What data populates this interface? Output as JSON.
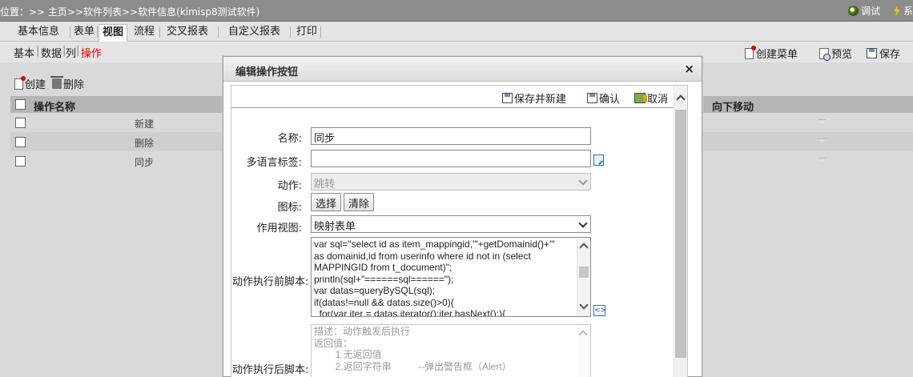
{
  "topbar": {
    "breadcrumb": "位置：>> 主页>>软件列表>>软件信息(kimisp8测试软件)",
    "debug_label": "调试",
    "sys_label": "系"
  },
  "tabs": [
    {
      "label": "基本信息"
    },
    {
      "label": "表单"
    },
    {
      "label": "视图"
    },
    {
      "label": "流程"
    },
    {
      "label": "交叉报表"
    },
    {
      "label": "自定义报表"
    },
    {
      "label": "打印"
    }
  ],
  "subtabs": [
    {
      "label": "基本"
    },
    {
      "label": "数据"
    },
    {
      "label": "列"
    },
    {
      "label": "操作"
    }
  ],
  "actions_right": {
    "create_menu": "创建菜单",
    "preview": "预览",
    "save": "保存"
  },
  "list": {
    "create": "创建",
    "delete": "删除",
    "col_name": "操作名称",
    "col_move": "向下移动",
    "rows": [
      {
        "name": "新建"
      },
      {
        "name": "删除"
      },
      {
        "name": "同步"
      }
    ]
  },
  "dialog": {
    "title": "编辑操作按钮",
    "close": "×",
    "save_new": "保存并新建",
    "confirm": "确认",
    "cancel": "取消",
    "fields": {
      "name_label": "名称:",
      "name_value": "同步",
      "i18n_label": "多语言标签:",
      "i18n_value": "",
      "action_label": "动作:",
      "action_value": "跳转",
      "icon_label": "图标:",
      "icon_select": "选择",
      "icon_clear": "清除",
      "view_label": "作用视图:",
      "view_value": "映射表单",
      "pre_script_label": "动作执行前脚本:",
      "pre_script": "var sql=\"select id as item_mappingid,'\"+getDomainid()+\"'\nas domainid,id from userinfo where id not in (select\nMAPPINGID from t_document)\";\nprintln(sql+\"======sql======\");\nvar datas=queryBySQL(sql);\nif(datas!=null && datas.size()>0){\n  for(var iter = datas.iterator();iter.hasNext();){",
      "post_script_label": "动作执行后脚本:",
      "post_script": "描述：动作触发后执行\n返回值：\n        1.无返回值\n        2.返回字符串          --弹出警告框（Alert）"
    }
  }
}
